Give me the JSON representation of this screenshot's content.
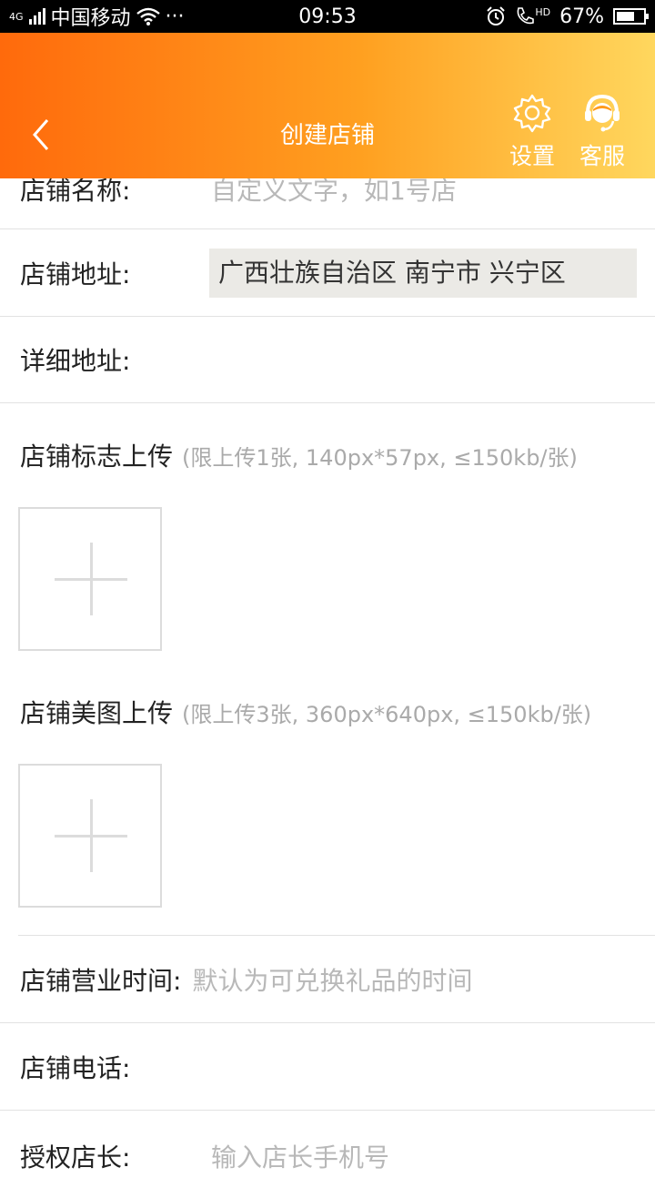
{
  "status_bar": {
    "network": "4G",
    "carrier": "中国移动",
    "more": "···",
    "time": "09:53",
    "hd": "HD",
    "battery": "67%",
    "battery_level": 0.67
  },
  "header": {
    "title": "创建店铺",
    "settings_label": "设置",
    "service_label": "客服"
  },
  "form": {
    "name_label": "店铺名称:",
    "name_placeholder": "自定义文字，如1号店",
    "address_label": "店铺地址:",
    "address_value": "广西壮族自治区 南宁市 兴宁区",
    "detail_label": "详细地址:",
    "detail_value": "",
    "logo_title": "店铺标志上传",
    "logo_hint": "(限上传1张, 140px*57px, ≤150kb/张)",
    "photo_title": "店铺美图上传",
    "photo_hint": "(限上传3张, 360px*640px, ≤150kb/张)",
    "hours_label": "店铺营业时间:",
    "hours_placeholder": "默认为可兑换礼品的时间",
    "phone_label": "店铺电话:",
    "phone_value": "",
    "manager_label": "授权店长:",
    "manager_placeholder": "输入店长手机号"
  }
}
